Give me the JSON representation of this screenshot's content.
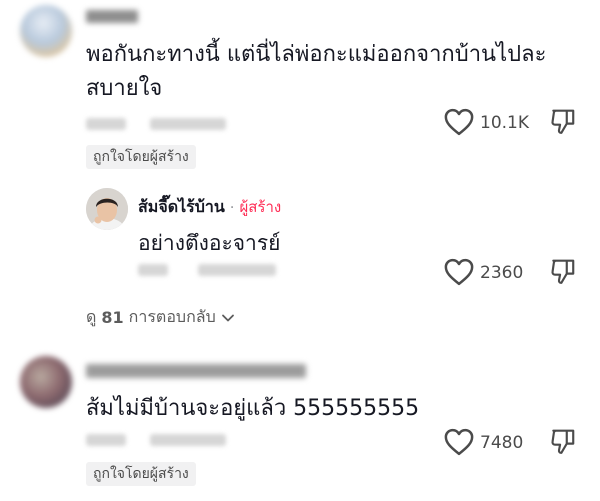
{
  "comments": [
    {
      "text_line1": "พอกันกะทางนี้ แต่นี่ไล่พ่อกะแม่ออกจากบ้านไปละ",
      "text_line2": "สบายใจ",
      "likes": "10.1K",
      "badge": "ถูกใจโดยผู้สร้าง"
    },
    {
      "text": "ส้มไม่มีบ้านจะอยู่แล้ว 555555555",
      "likes": "7480",
      "badge": "ถูกใจโดยผู้สร้าง"
    }
  ],
  "reply": {
    "username": "ส้มจี๊ดไร้บ้าน",
    "separator": "·",
    "creator_label": "ผู้สร้าง",
    "text": "อย่างตึงอะจารย์",
    "likes": "2360"
  },
  "view_replies": {
    "prefix": "ดู",
    "count": "81",
    "suffix": "การตอบกลับ"
  },
  "icons": {
    "like": "heart-outline-icon",
    "dislike": "thumbs-down-icon",
    "expand": "chevron-down-icon"
  },
  "colors": {
    "creator_accent": "#fe2c55",
    "badge_bg": "#f1f1f2",
    "text_primary": "#161823",
    "text_secondary": "#4b4b4b"
  }
}
